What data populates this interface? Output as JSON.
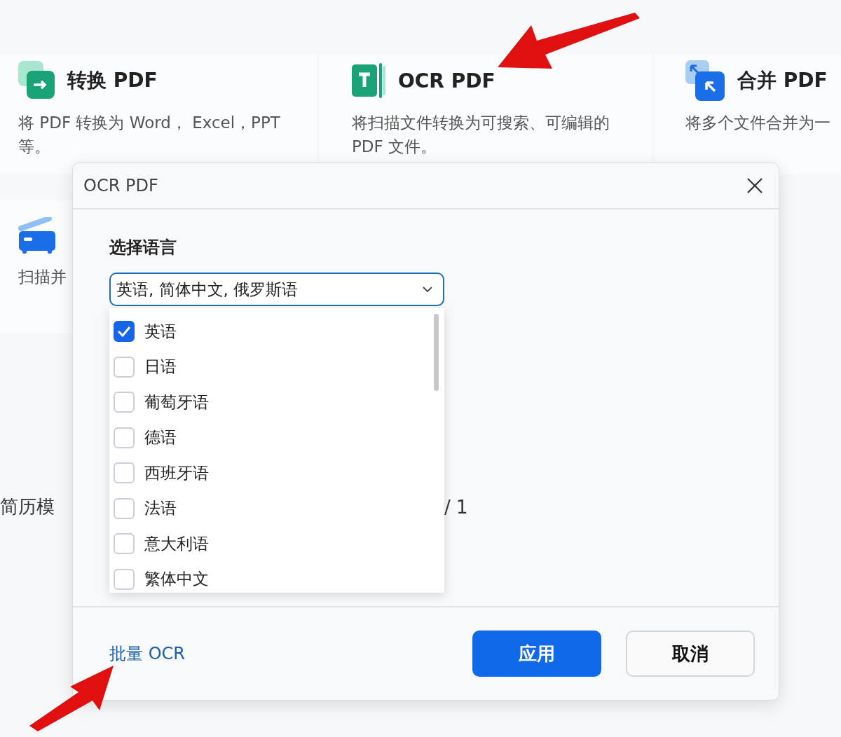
{
  "tools": [
    {
      "kind": "convert",
      "title": "转换 PDF",
      "description": "将 PDF 转换为 Word， Excel，PPT 等。"
    },
    {
      "kind": "ocr",
      "title": "OCR PDF",
      "description": "将扫描文件转换为可搜索、可编辑的 PDF 文件。"
    },
    {
      "kind": "merge",
      "title": "合并 PDF",
      "description": "将多个文件合并为一"
    },
    {
      "kind": "scan",
      "description": "扫描并"
    }
  ],
  "background_text": {
    "left": "简历模",
    "page_count": "/ 1"
  },
  "dialog": {
    "title": "OCR PDF",
    "section_label": "选择语言",
    "language_select": {
      "value": "英语, 简体中文, 俄罗斯语",
      "expanded": true
    },
    "options": [
      {
        "label": "英语",
        "checked": true
      },
      {
        "label": "日语",
        "checked": false
      },
      {
        "label": "葡萄牙语",
        "checked": false
      },
      {
        "label": "德语",
        "checked": false
      },
      {
        "label": "西班牙语",
        "checked": false
      },
      {
        "label": "法语",
        "checked": false
      },
      {
        "label": "意大利语",
        "checked": false
      },
      {
        "label": "繁体中文",
        "checked": false
      }
    ],
    "batch_link": "批量 OCR",
    "buttons": [
      {
        "label": "应用",
        "kind": "primary"
      },
      {
        "label": "取消",
        "kind": "secondary"
      }
    ]
  }
}
